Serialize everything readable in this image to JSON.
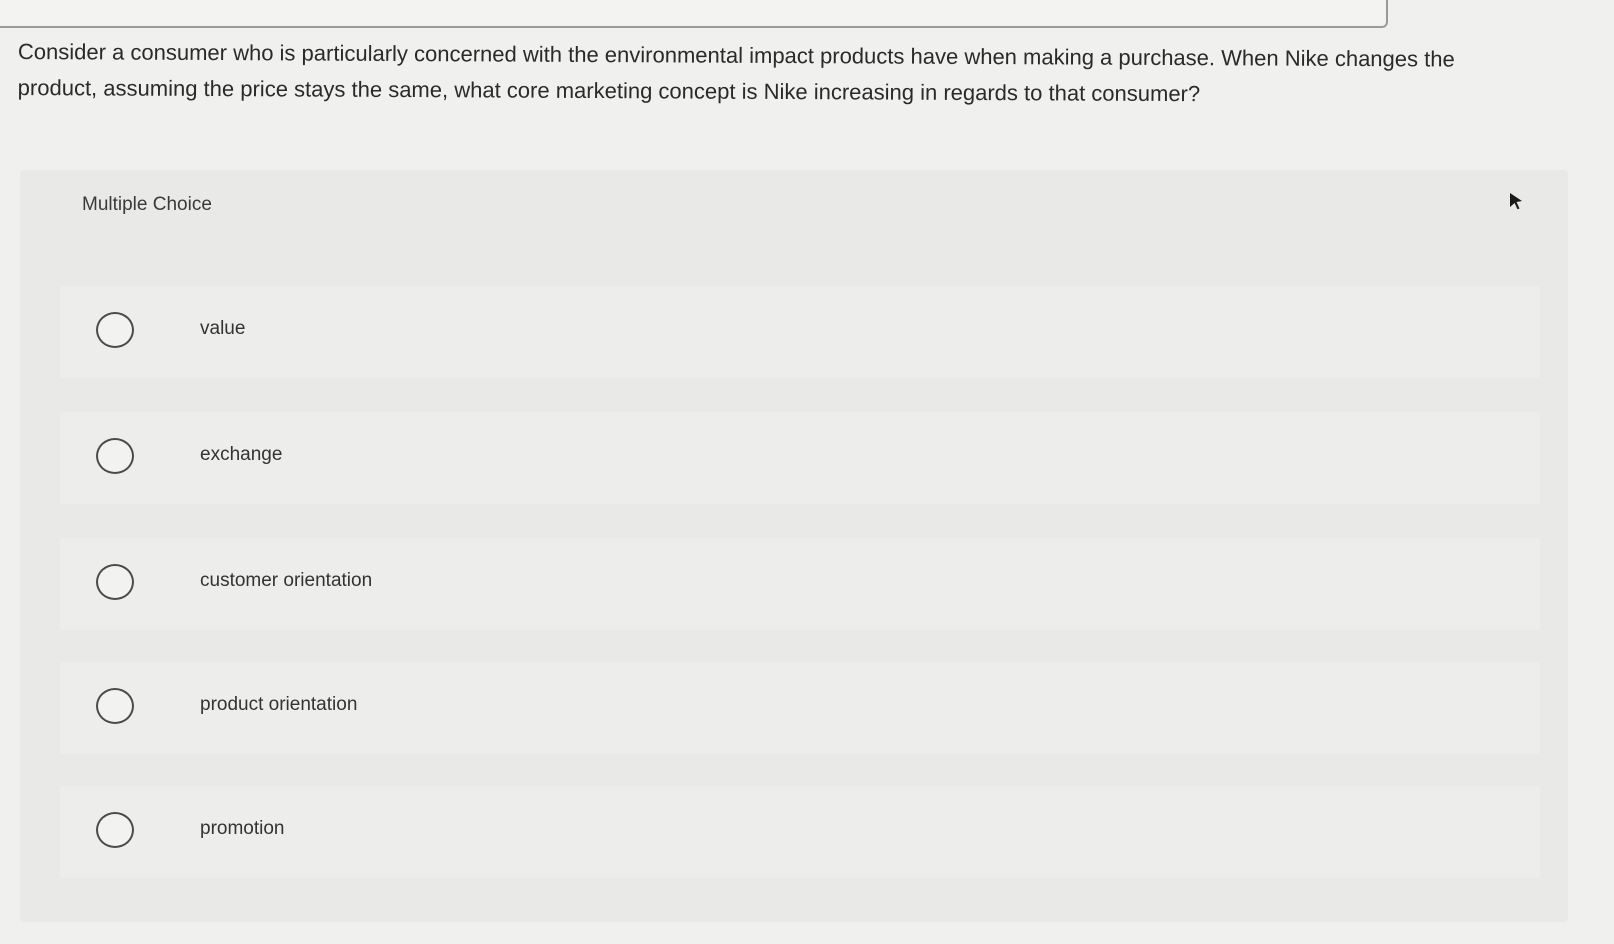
{
  "question": {
    "text": "Consider a consumer who is particularly concerned with the environmental impact products have when making a purchase. When Nike changes the product, assuming the price stays the same, what core marketing concept is Nike increasing in regards to that consumer?"
  },
  "multiple_choice": {
    "label": "Multiple Choice",
    "options": [
      {
        "label": "value",
        "selected": false
      },
      {
        "label": "exchange",
        "selected": false
      },
      {
        "label": "customer orientation",
        "selected": false
      },
      {
        "label": "product orientation",
        "selected": false
      },
      {
        "label": "promotion",
        "selected": false
      }
    ]
  },
  "icons": {
    "radio": "radio-circle-icon",
    "cursor": "mouse-pointer-icon"
  },
  "colors": {
    "background": "#f0f0ef",
    "panel": "#e9e9e8",
    "text": "#2c2c2c",
    "radio_border": "#4a4a4a"
  }
}
